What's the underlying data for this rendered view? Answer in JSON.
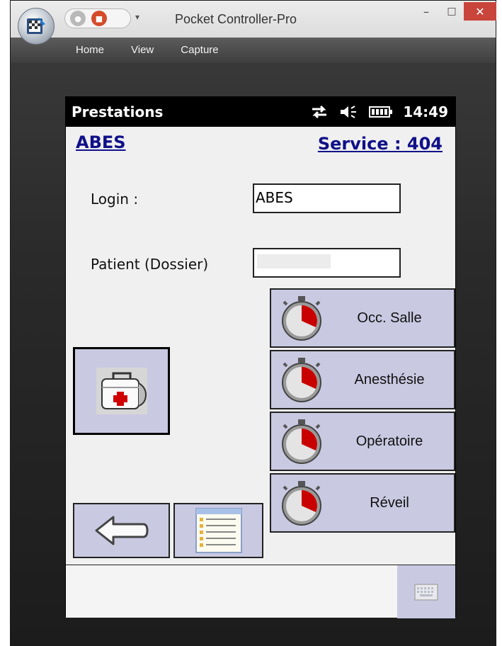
{
  "window": {
    "title": "Pocket Controller-Pro",
    "minimize": "–",
    "maximize": "□",
    "close": "✕"
  },
  "menu": {
    "items": [
      {
        "label": "Home"
      },
      {
        "label": "View"
      },
      {
        "label": "Capture"
      }
    ]
  },
  "device": {
    "status": {
      "title": "Prestations",
      "time": "14:49"
    },
    "header": {
      "user_link": "ABES",
      "service_link": "Service : 404"
    },
    "form": {
      "login_label": "Login :",
      "login_value": "ABES",
      "patient_label": "Patient (Dossier)",
      "patient_value": ""
    },
    "timers": [
      {
        "label": "Occ. Salle"
      },
      {
        "label": "Anesthésie"
      },
      {
        "label": "Opératoire"
      },
      {
        "label": "Réveil"
      }
    ]
  },
  "colors": {
    "button_bg": "#c9c9e2",
    "link": "#10108a",
    "status_bg": "#000000",
    "close_button": "#c9453b"
  },
  "icons": {
    "app": "pocket-controller-icon",
    "medical": "medical-kit-icon",
    "timer": "stopwatch-icon",
    "back": "back-arrow-icon",
    "list": "list-icon",
    "keyboard": "keyboard-icon"
  }
}
